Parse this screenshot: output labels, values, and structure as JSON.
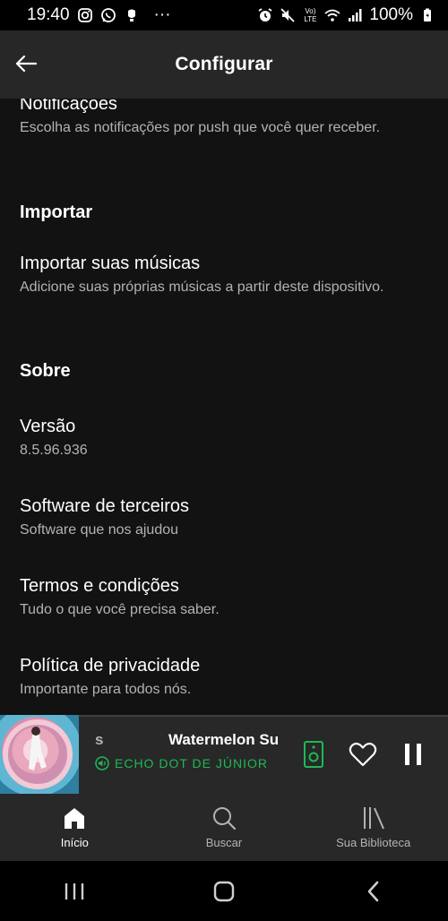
{
  "status_bar": {
    "time": "19:40",
    "more": "···",
    "lte_label": "Vo) LTE",
    "battery": "100%",
    "left_icons": [
      "instagram-icon",
      "whatsapp-icon",
      "notification-icon"
    ],
    "right_icons": [
      "alarm-icon",
      "mute-icon",
      "volte-icon",
      "wifi-icon",
      "signal-icon",
      "battery-icon"
    ]
  },
  "header": {
    "title": "Configurar",
    "back_icon": "back-arrow-icon"
  },
  "settings": {
    "notifications": {
      "title": "Notificações",
      "subtitle": "Escolha as notificações por push que você quer receber."
    },
    "import_section": "Importar",
    "import_music": {
      "title": "Importar suas músicas",
      "subtitle": "Adicione suas próprias músicas a partir deste dispositivo."
    },
    "about_section": "Sobre",
    "version": {
      "title": "Versão",
      "subtitle": "8.5.96.936"
    },
    "third_party": {
      "title": "Software de terceiros",
      "subtitle": "Software que nos ajudou"
    },
    "terms": {
      "title": "Termos e condições",
      "subtitle": "Tudo o que você precisa saber."
    },
    "privacy": {
      "title": "Política de privacidade",
      "subtitle": "Importante para todos nós."
    }
  },
  "mini_player": {
    "title_prefix": "s",
    "title": "Watermelon Su",
    "device": "ECHO DOT DE JÚNIOR",
    "progress": 0.15,
    "accent_color": "#1db954"
  },
  "bottom_nav": {
    "items": [
      {
        "label": "Início",
        "icon": "home-icon",
        "active": true
      },
      {
        "label": "Buscar",
        "icon": "search-icon",
        "active": false
      },
      {
        "label": "Sua Biblioteca",
        "icon": "library-icon",
        "active": false
      }
    ]
  },
  "system_nav": {
    "buttons": [
      "recent-apps-icon",
      "home-button-icon",
      "back-icon"
    ]
  }
}
